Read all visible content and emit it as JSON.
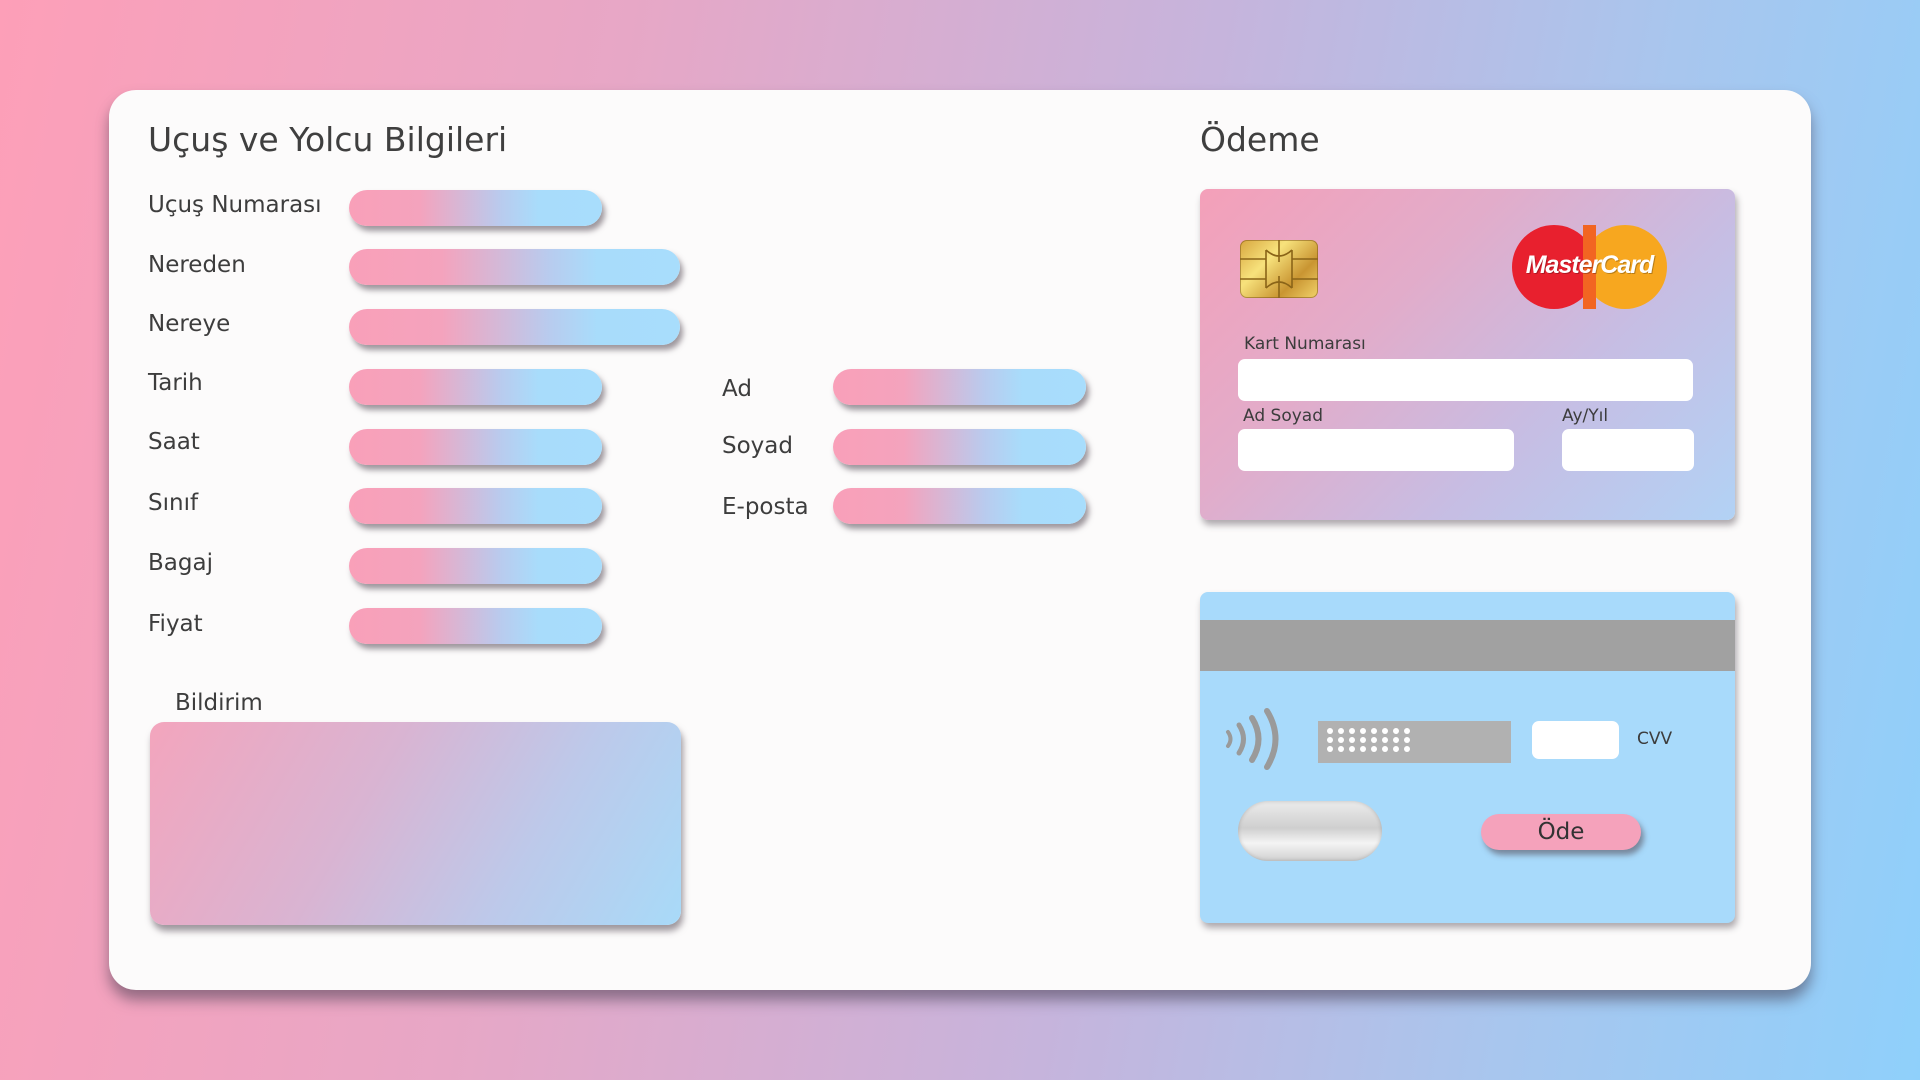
{
  "flight_section": {
    "title": "Uçuş ve Yolcu Bilgileri",
    "fields": [
      {
        "label": "Uçuş Numarası",
        "value": ""
      },
      {
        "label": "Nereden",
        "value": ""
      },
      {
        "label": "Nereye",
        "value": ""
      },
      {
        "label": "Tarih",
        "value": ""
      },
      {
        "label": "Saat",
        "value": ""
      },
      {
        "label": "Sınıf",
        "value": ""
      },
      {
        "label": "Bagaj",
        "value": ""
      },
      {
        "label": "Fiyat",
        "value": ""
      }
    ],
    "notification_label": "Bildirim",
    "notification_value": ""
  },
  "passenger_section": {
    "fields": [
      {
        "label": "Ad",
        "value": ""
      },
      {
        "label": "Soyad",
        "value": ""
      },
      {
        "label": "E-posta",
        "value": ""
      }
    ]
  },
  "payment_section": {
    "title": "Ödeme",
    "card_front": {
      "brand": "MasterCard",
      "card_number_label": "Kart Numarası",
      "card_number_value": "",
      "name_label": "Ad Soyad",
      "name_value": "",
      "expiry_label": "Ay/Yıl",
      "expiry_value": ""
    },
    "card_back": {
      "cvv_label": "CVV",
      "cvv_value": "",
      "pay_button": "Öde"
    }
  },
  "colors": {
    "pink": "#f9a0b9",
    "blue": "#a8dcfb",
    "panel": "#fcfbfb",
    "stripe": "#a1a1a1"
  },
  "icons": {
    "chip": "card-chip-icon",
    "contactless": "contactless-icon",
    "brand_logo": "mastercard-logo"
  }
}
